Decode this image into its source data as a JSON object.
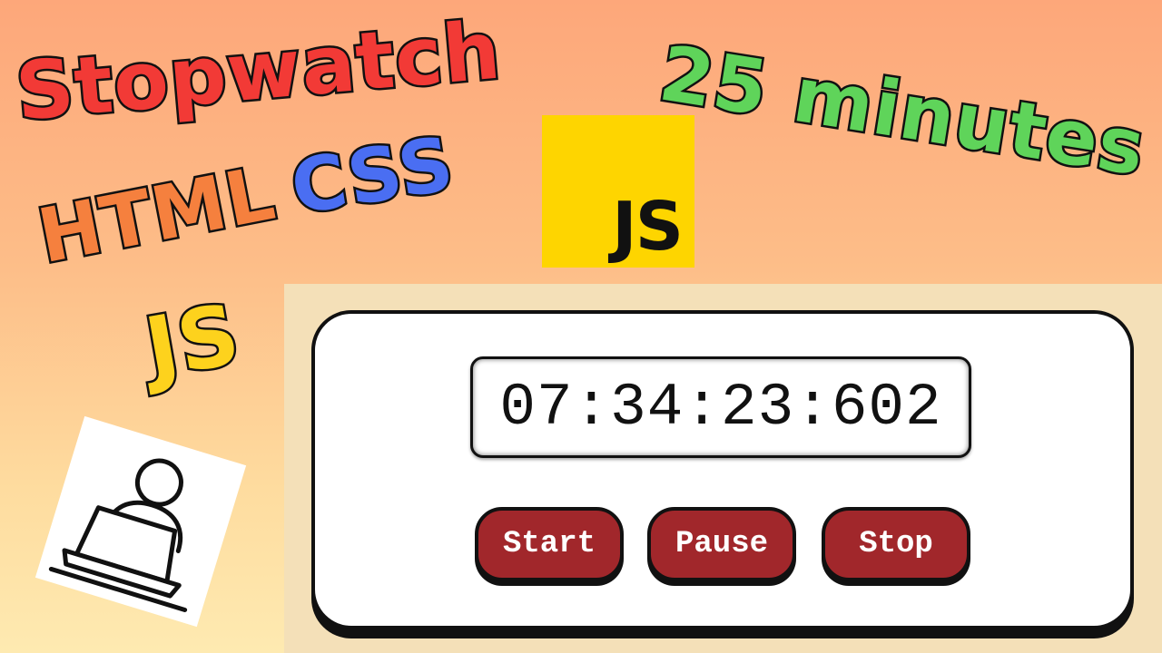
{
  "thumbnail": {
    "titles": {
      "stopwatch": "Stopwatch",
      "duration": "25 minutes",
      "html": "HTML",
      "css": "CSS",
      "js": "JS"
    },
    "js_logo": {
      "text": "JS"
    },
    "illustration": {
      "icon": "person-at-laptop-icon"
    }
  },
  "stopwatch": {
    "display": "07:34:23:602",
    "buttons": {
      "start": "Start",
      "pause": "Pause",
      "stop": "Stop"
    }
  },
  "colors": {
    "stopwatch_title": "#f23a36",
    "duration_title": "#5fd45a",
    "html_title": "#f5803e",
    "css_title": "#4a6ef2",
    "js_title": "#fdd21d",
    "js_logo_bg": "#fed500",
    "button_bg": "#a1272b",
    "panel_bg": "#f4e0b8"
  }
}
